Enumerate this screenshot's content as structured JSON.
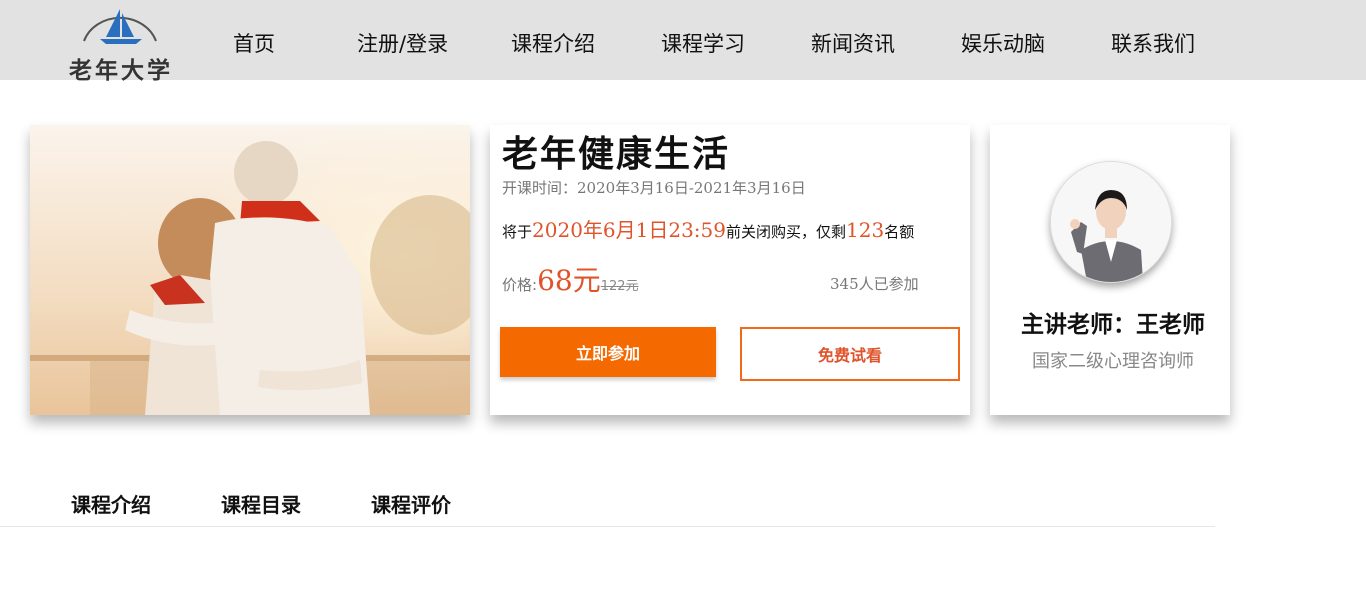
{
  "header": {
    "logo_text": "老年大学",
    "nav": [
      "首页",
      "注册/登录",
      "课程介绍",
      "课程学习",
      "新闻资讯",
      "娱乐动脑",
      "联系我们"
    ]
  },
  "course": {
    "title": "老年健康生活",
    "time_label": "开课时间：",
    "time_value": "2020年3月16日-2021年3月16日",
    "deadline_prefix": "将于",
    "deadline_date": "2020年6月1日23:59",
    "deadline_mid": "前关闭购买，仅剩",
    "remaining": "123",
    "deadline_suffix": "名额",
    "price_label": "价格:",
    "price": "68元",
    "old_price": "122元",
    "participants": "345人已参加",
    "join_button": "立即参加",
    "trial_button": "免费试看"
  },
  "teacher": {
    "name": "主讲老师：王老师",
    "title": "国家二级心理咨询师"
  },
  "tabs": [
    "课程介绍",
    "课程目录",
    "课程评价"
  ],
  "colors": {
    "accent": "#f56a00",
    "price_red": "#e0542b",
    "header_bg": "#e2e2e2"
  }
}
